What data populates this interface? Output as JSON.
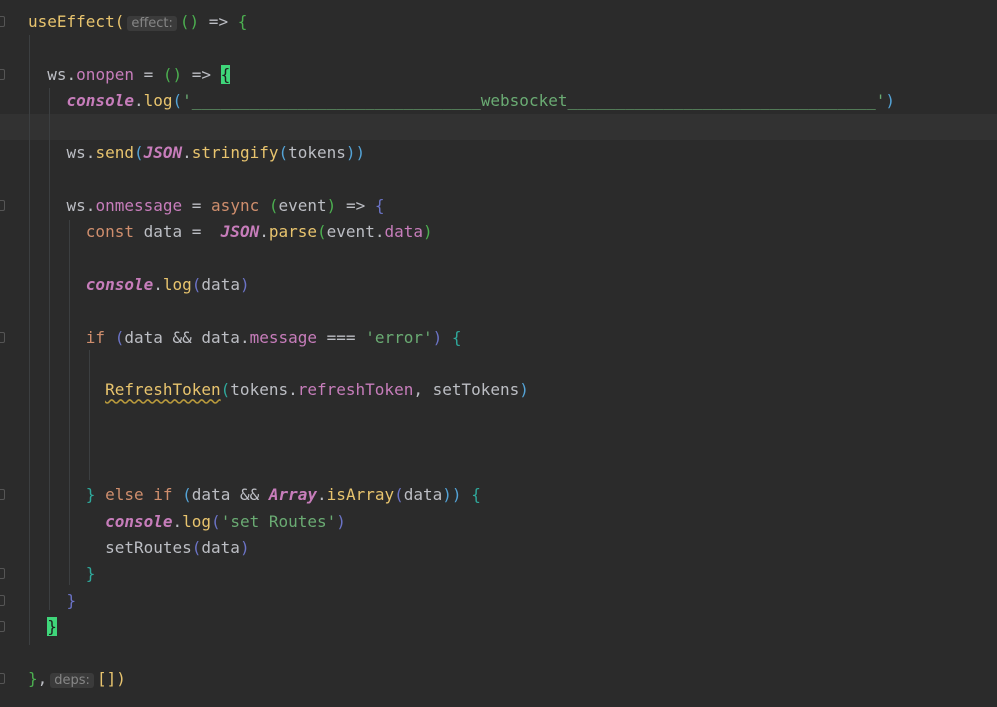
{
  "editor": {
    "colors": {
      "background": "#2b2b2b",
      "keyword": "#cf8e6d",
      "function": "#e8c46e",
      "string": "#6aab73",
      "property": "#c77dbb",
      "brace_match": "#3fd67a"
    },
    "lines": [
      {
        "tokens": [
          [
            "useEffect(",
            "fn"
          ],
          [
            "effect:",
            "hint"
          ],
          [
            "()",
            "p1"
          ],
          [
            " => ",
            ""
          ],
          [
            "{",
            "p1"
          ]
        ],
        "fold": true
      },
      {
        "tokens": []
      },
      {
        "tokens": [
          [
            "  ws.",
            ""
          ],
          [
            "onopen",
            "prop"
          ],
          [
            " = ",
            ""
          ],
          [
            "()",
            "p1"
          ],
          [
            " => ",
            ""
          ],
          [
            "{",
            "match"
          ]
        ],
        "fold": true
      },
      {
        "tokens": [
          [
            "    ",
            ""
          ],
          [
            "console",
            "glob"
          ],
          [
            ".",
            ""
          ],
          [
            "log",
            "fn"
          ],
          [
            "(",
            "p2"
          ],
          [
            "'______________________________websocket________________________________'",
            "str"
          ],
          [
            ")",
            "p2"
          ]
        ]
      },
      {
        "tokens": [],
        "current": true
      },
      {
        "tokens": [
          [
            "    ws.",
            ""
          ],
          [
            "send",
            "fn"
          ],
          [
            "(",
            "p2"
          ],
          [
            "JSON",
            "glob"
          ],
          [
            ".",
            ""
          ],
          [
            "stringify",
            "fn"
          ],
          [
            "(",
            "p2"
          ],
          [
            "tokens",
            ""
          ],
          [
            "))",
            "p2"
          ]
        ]
      },
      {
        "tokens": []
      },
      {
        "tokens": [
          [
            "    ws.",
            ""
          ],
          [
            "onmessage",
            "prop"
          ],
          [
            " = ",
            ""
          ],
          [
            "async",
            "kw"
          ],
          [
            " ",
            ""
          ],
          [
            "(",
            "p1"
          ],
          [
            "event",
            ""
          ],
          [
            ")",
            "p1"
          ],
          [
            " => ",
            ""
          ],
          [
            "{",
            "p3"
          ]
        ],
        "fold": true
      },
      {
        "tokens": [
          [
            "      ",
            ""
          ],
          [
            "const",
            "kw"
          ],
          [
            " data =  ",
            ""
          ],
          [
            "JSON",
            "glob"
          ],
          [
            ".",
            ""
          ],
          [
            "parse",
            "fn"
          ],
          [
            "(",
            "p1"
          ],
          [
            "event.",
            ""
          ],
          [
            "data",
            "prop"
          ],
          [
            ")",
            "p1"
          ]
        ]
      },
      {
        "tokens": []
      },
      {
        "tokens": [
          [
            "      ",
            ""
          ],
          [
            "console",
            "glob"
          ],
          [
            ".",
            ""
          ],
          [
            "log",
            "fn"
          ],
          [
            "(",
            "p3"
          ],
          [
            "data",
            ""
          ],
          [
            ")",
            "p3"
          ]
        ]
      },
      {
        "tokens": []
      },
      {
        "tokens": [
          [
            "      ",
            ""
          ],
          [
            "if",
            "kw"
          ],
          [
            " ",
            ""
          ],
          [
            "(",
            "p3"
          ],
          [
            "data && data.",
            ""
          ],
          [
            "message",
            "prop"
          ],
          [
            " === ",
            ""
          ],
          [
            "'error'",
            "str"
          ],
          [
            ")",
            "p3"
          ],
          [
            " ",
            ""
          ],
          [
            "{",
            "p4"
          ]
        ],
        "fold": true
      },
      {
        "tokens": []
      },
      {
        "tokens": [
          [
            "        ",
            ""
          ],
          [
            "RefreshToken",
            "fn warn"
          ],
          [
            "(",
            "p4"
          ],
          [
            "tokens.",
            ""
          ],
          [
            "refreshToken",
            "prop"
          ],
          [
            ", setTokens",
            ""
          ],
          [
            ")",
            "p2"
          ]
        ]
      },
      {
        "tokens": []
      },
      {
        "tokens": []
      },
      {
        "tokens": []
      },
      {
        "tokens": [
          [
            "      ",
            ""
          ],
          [
            "}",
            "p4"
          ],
          [
            " ",
            ""
          ],
          [
            "else if",
            "kw"
          ],
          [
            " ",
            ""
          ],
          [
            "(",
            "p2"
          ],
          [
            "data && ",
            ""
          ],
          [
            "Array",
            "glob"
          ],
          [
            ".",
            ""
          ],
          [
            "isArray",
            "fn"
          ],
          [
            "(",
            "p3"
          ],
          [
            "data",
            ""
          ],
          [
            "))",
            "p2"
          ],
          [
            " ",
            ""
          ],
          [
            "{",
            "p4"
          ]
        ],
        "fold": true
      },
      {
        "tokens": [
          [
            "        ",
            ""
          ],
          [
            "console",
            "glob"
          ],
          [
            ".",
            ""
          ],
          [
            "log",
            "fn"
          ],
          [
            "(",
            "p3"
          ],
          [
            "'set Routes'",
            "str"
          ],
          [
            ")",
            "p3"
          ]
        ]
      },
      {
        "tokens": [
          [
            "        setRoutes",
            ""
          ],
          [
            "(",
            "p3"
          ],
          [
            "data",
            ""
          ],
          [
            ")",
            "p3"
          ]
        ]
      },
      {
        "tokens": [
          [
            "      ",
            ""
          ],
          [
            "}",
            "p4"
          ]
        ],
        "fold": true
      },
      {
        "tokens": [
          [
            "    ",
            ""
          ],
          [
            "}",
            "p3"
          ]
        ],
        "fold": true
      },
      {
        "tokens": [
          [
            "  ",
            ""
          ],
          [
            "}",
            "match"
          ]
        ],
        "fold": true
      },
      {
        "tokens": []
      },
      {
        "tokens": [
          [
            "}",
            "p1"
          ],
          [
            ",",
            ""
          ],
          [
            "deps:",
            "hint"
          ],
          [
            "[]",
            "py"
          ],
          [
            ")",
            "fn"
          ]
        ],
        "fold": true
      }
    ]
  }
}
